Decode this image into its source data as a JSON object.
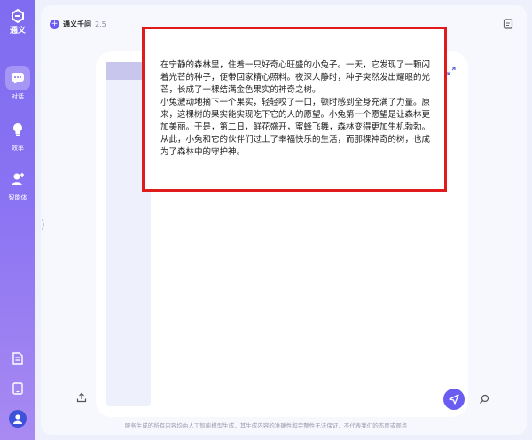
{
  "sidebar": {
    "logo_text": "通义",
    "items": [
      {
        "label": "对话",
        "icon": "chat-icon"
      },
      {
        "label": "效率",
        "icon": "lightbulb-icon"
      },
      {
        "label": "智能体",
        "icon": "agent-icon"
      }
    ],
    "bottom_icons": [
      "document-icon",
      "tablet-icon"
    ],
    "avatar_icon": "user-avatar-icon"
  },
  "header": {
    "model_name": "通义千问",
    "model_version": "2.5"
  },
  "story": {
    "paragraphs": [
      "在宁静的森林里，住着一只好奇心旺盛的小兔子。一天，它发现了一颗闪着光芒的种子，便带回家精心照料。夜深人静时，种子突然发出耀眼的光芒，长成了一棵结满金色果实的神奇之树。",
      "小兔激动地摘下一个果实，轻轻咬了一口，顿时感到全身充满了力量。原来，这棵树的果实能实现吃下它的人的愿望。小兔第一个愿望是让森林更加美丽。于是，第二日，鲜花盛开，蜜蜂飞舞，森林变得更加生机勃勃。从此，小兔和它的伙伴们过上了幸福快乐的生活，而那棵神奇的树，也成为了森林中的守护神。"
    ]
  },
  "footer": {
    "disclaimer": "服务生成的所有内容均由人工智能模型生成，其生成内容的准确性和完整性无法保证，不代表我们的态度或观点"
  },
  "colors": {
    "accent": "#6a5cf0",
    "highlight_border": "#e01b1b"
  }
}
